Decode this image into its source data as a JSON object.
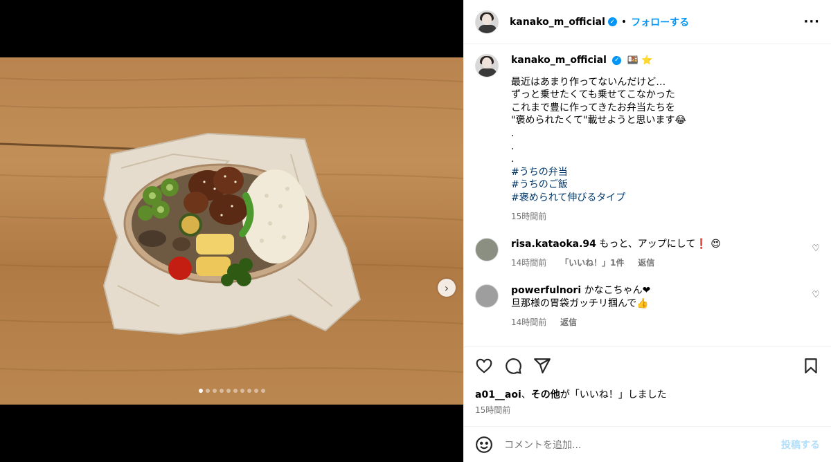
{
  "post": {
    "username": "kanako_m_official",
    "follow_label": "フォローする",
    "separator": "•",
    "more_label": "···"
  },
  "caption": {
    "username": "kanako_m_official",
    "emoji": "🍱 ⭐",
    "lines": [
      "最近はあまり作ってないんだけど…",
      "ずっと乗せたくても乗せてこなかった",
      "これまで豊に作ってきたお弁当たちを",
      "\"褒められたくて\"載せようと思います😂",
      ".",
      ".",
      "."
    ],
    "hashtags": [
      "#うちの弁当",
      "#うちのご飯",
      "#褒められて伸びるタイプ"
    ],
    "time": "15時間前"
  },
  "comments": [
    {
      "username": "risa.kataoka.94",
      "lines": [
        "もっと、アップにして❗️ 😍"
      ],
      "time": "14時間前",
      "likes": "「いいね！」1件",
      "reply": "返信"
    },
    {
      "username": "powerfulnori",
      "lines": [
        "かなこちゃん❤",
        "旦那様の胃袋ガッチリ掴んで👍"
      ],
      "time": "14時間前",
      "reply": "返信"
    }
  ],
  "likes_line": {
    "user": "a01__aoi",
    "connector": "、",
    "others": "その他",
    "suffix": "が「いいね！」しました"
  },
  "post_time": "15時間前",
  "add_comment": {
    "placeholder": "コメントを追加...",
    "post_label": "投稿する"
  },
  "carousel": {
    "count": 10,
    "active": 0
  }
}
